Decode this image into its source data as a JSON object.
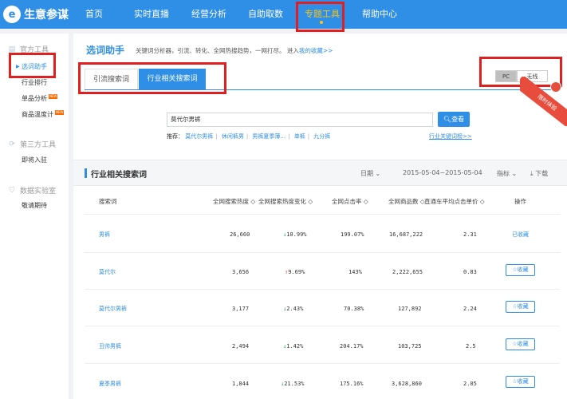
{
  "app": {
    "logo_glyph": "e",
    "name": "生意参谋"
  },
  "nav": [
    {
      "label": "首页"
    },
    {
      "label": "实时直播"
    },
    {
      "label": "经营分析"
    },
    {
      "label": "自助取数"
    },
    {
      "label": "专题工具",
      "active": true
    },
    {
      "label": "帮助中心"
    }
  ],
  "sidebar": {
    "groups": [
      {
        "label": "官方工具",
        "icon": "document-icon"
      },
      {
        "label": "第三方工具",
        "icon": "sync-icon"
      },
      {
        "label": "数据实验室",
        "icon": "shield-icon"
      }
    ],
    "items": [
      {
        "label": "选词助手",
        "active": true
      },
      {
        "label": "行业排行"
      },
      {
        "label": "单品分析",
        "badge": "NEW"
      },
      {
        "label": "商品温度计",
        "badge": "NEW"
      },
      {
        "label": "即将入驻"
      },
      {
        "label": "敬请期待"
      }
    ]
  },
  "page": {
    "title": "选词助手",
    "subtitle": "关键词分析器，引流、转化、全网热搜趋势，一网打尽。 进入",
    "subtitle_link": "我的收藏>>"
  },
  "tabs": [
    {
      "label": "引流搜索词"
    },
    {
      "label": "行业相关搜索词",
      "active": true
    }
  ],
  "device": {
    "pc": "PC",
    "wireless": "无线"
  },
  "ribbon": "限时体验",
  "search": {
    "value": "莫代尔男裤",
    "button": "查看"
  },
  "recommend": {
    "label": "推荐：",
    "keywords": [
      "莫代尔男裤",
      "休闲裤男",
      "男裤夏季薄...",
      "单裤",
      "九分裤"
    ],
    "more": "行业关键词榜>>"
  },
  "section": {
    "title": "行业相关搜索词",
    "date_label": "日期",
    "date_range": "2015-05-04~2015-05-04",
    "metric_label": "指标",
    "download": "下载"
  },
  "table": {
    "headers": [
      "搜索词",
      "全网搜索热度 ◇",
      "全网搜索热度变化 ◇",
      "全网点击率 ◇",
      "全网商品数 ◇",
      "直通车平均点击单价 ◇",
      "操作"
    ],
    "rows": [
      {
        "keyword": "男裤",
        "heat": "26,660",
        "change_dir": "down",
        "change": "10.99%",
        "ctr": "199.07%",
        "goods": "16,687,222",
        "cpc": "2.31",
        "op": "已收藏",
        "op_done": true
      },
      {
        "keyword": "莫代尔",
        "heat": "3,656",
        "change_dir": "up",
        "change": "9.69%",
        "ctr": "143%",
        "goods": "2,222,655",
        "cpc": "0.83",
        "op": "☆收藏",
        "op_done": false
      },
      {
        "keyword": "莫代尔男裤",
        "heat": "3,177",
        "change_dir": "down",
        "change": "2.43%",
        "ctr": "70.38%",
        "goods": "127,892",
        "cpc": "2.24",
        "op": "☆收藏",
        "op_done": false
      },
      {
        "keyword": "丑帅男裤",
        "heat": "2,494",
        "change_dir": "down",
        "change": "1.42%",
        "ctr": "204.17%",
        "goods": "103,725",
        "cpc": "2.5",
        "op": "☆收藏",
        "op_done": false
      },
      {
        "keyword": "夏季男裤",
        "heat": "1,844",
        "change_dir": "down",
        "change": "21.53%",
        "ctr": "175.16%",
        "goods": "3,628,860",
        "cpc": "2.05",
        "op": "☆收藏",
        "op_done": false
      }
    ]
  },
  "colors": {
    "brand": "#2f8fe6",
    "highlight": "#e02020",
    "active_nav": "#f7c21c"
  }
}
